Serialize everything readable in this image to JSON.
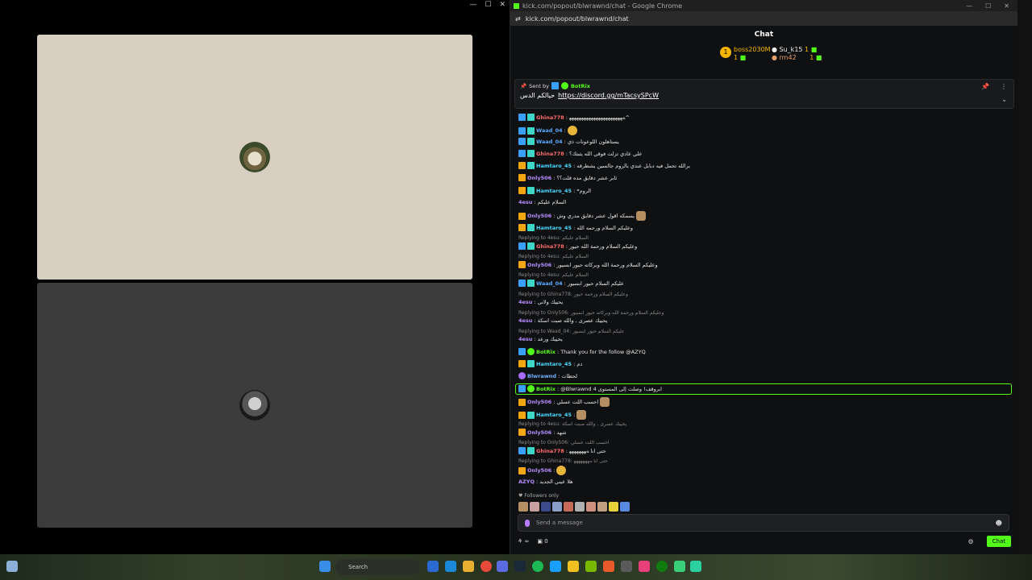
{
  "browser": {
    "title": "kick.com/popout/blwrawnd/chat - Google Chrome",
    "url": "kick.com/popout/blwrawnd/chat"
  },
  "chat": {
    "header": "Chat",
    "top_gifters": [
      {
        "name": "boss2030M",
        "count": "1"
      },
      {
        "name": "Su_k15",
        "count": "1"
      },
      {
        "name": "rm42",
        "count": "1"
      }
    ],
    "pinned": {
      "sent_by_label": "Sent by",
      "sender": "BotRix",
      "text": "حيالكم الدس",
      "link": "https://discord.gg/mTacsySPcW"
    },
    "messages": [
      {
        "user": "Ghina778",
        "text": ": ﻪﻬﻬﻬﻬﻬﻬﻬﻬﻬﻬﻬﻬﻬﻬﻬﻬﻬﻬﻬﻬﻬﻬ^"
      },
      {
        "user": "Waad_04",
        "text": ":"
      },
      {
        "user": "Waad_04",
        "text": ": يستاهلون اللوعونات ذي"
      },
      {
        "user": "Ghina778",
        "text": ": علي عادي تزلت فوقي الله يثبتك؟"
      },
      {
        "user": "Hamtaro_45",
        "text": ": برالله تحمل فيه دبابل عندي بالروم جالسين يشطرقه"
      },
      {
        "user": "Only506",
        "text": ": ثابر عشر دقايق مده قلت؟؟"
      },
      {
        "user": "Hamtaro_45",
        "text": ": *الروم"
      },
      {
        "user": "4esu",
        "text": ": السلام عليكم"
      },
      {
        "user": "Only506",
        "text": ": يسمكه اقول عشر دقايق مدري وش"
      },
      {
        "user": "Hamtaro_45",
        "text": ": وعليكم السلام ورحمه الله"
      },
      {
        "user": "Ghina778",
        "text": ": وعليكم السلام ورحمة الله حيور",
        "reply": "Replying to 4esu:",
        "reply_text": "السلام عليكم"
      },
      {
        "user": "Only506",
        "text": ": وعليكم السلام ورحمة الله وبركاته حيور ابسيور",
        "reply": "Replying to 4esu:",
        "reply_text": "السلام عليكم"
      },
      {
        "user": "Waad_04",
        "text": ": عليكم السلام حيور ابسيور",
        "reply": "Replying to 4esu:",
        "reply_text": "السلام عليكم"
      },
      {
        "user": "4esu",
        "text": ": يحييك ولاني",
        "reply": "Replying to Ghina778:",
        "reply_text": "وعليكم السلام ورحمة حيور"
      },
      {
        "user": "4esu",
        "text": ": يحييك عصرى , والله صبت اسكة",
        "reply": "Replying to Only506:",
        "reply_text": "وعليكم السلام ورحمة الله وبركاته حيور ابسيور"
      },
      {
        "user": "4esu",
        "text": ": يحييك ورعد",
        "reply": "Replying to Waad_04:",
        "reply_text": "عليكم السلام حيور ابسيور"
      },
      {
        "user": "BotRix",
        "text": ": Thank you for the follow @AZYQ"
      },
      {
        "user": "Hamtaro_45",
        "text": ": دم"
      },
      {
        "user": "Blwrawnd",
        "text": ": لحظات"
      },
      {
        "user": "BotRix",
        "text": ": @Blwrawnd ابروقف! وصلت إلى المستوى 4"
      },
      {
        "user": "Only506",
        "text": ": احسب اللت عسلي"
      },
      {
        "user": "Hamtaro_45",
        "text": ":"
      },
      {
        "user": "Only506",
        "text": ": شهد",
        "reply": "Replying to 4esu:",
        "reply_text": "يحييك عصرى , والله صبت اسكة"
      },
      {
        "user": "Ghina778",
        "text": ": حتى انا ﻪﻬﻬﻬﻬﻬﻬﻬ",
        "reply": "Replying to Only506:",
        "reply_text": "احسب اللت عسلي"
      },
      {
        "user": "Only506",
        "text": ":",
        "reply": "Replying to Ghina778:",
        "reply_text": "حتى انا ﻪﻬﻬﻬﻬﻬﻬﻬ"
      },
      {
        "user": "AZYQ",
        "text": ": هلا عيني الجديد"
      }
    ],
    "followers_only": "Followers only",
    "input_placeholder": "Send a message",
    "points": "0",
    "chat_button": "Chat"
  },
  "taskbar": {
    "search_placeholder": "Search"
  }
}
